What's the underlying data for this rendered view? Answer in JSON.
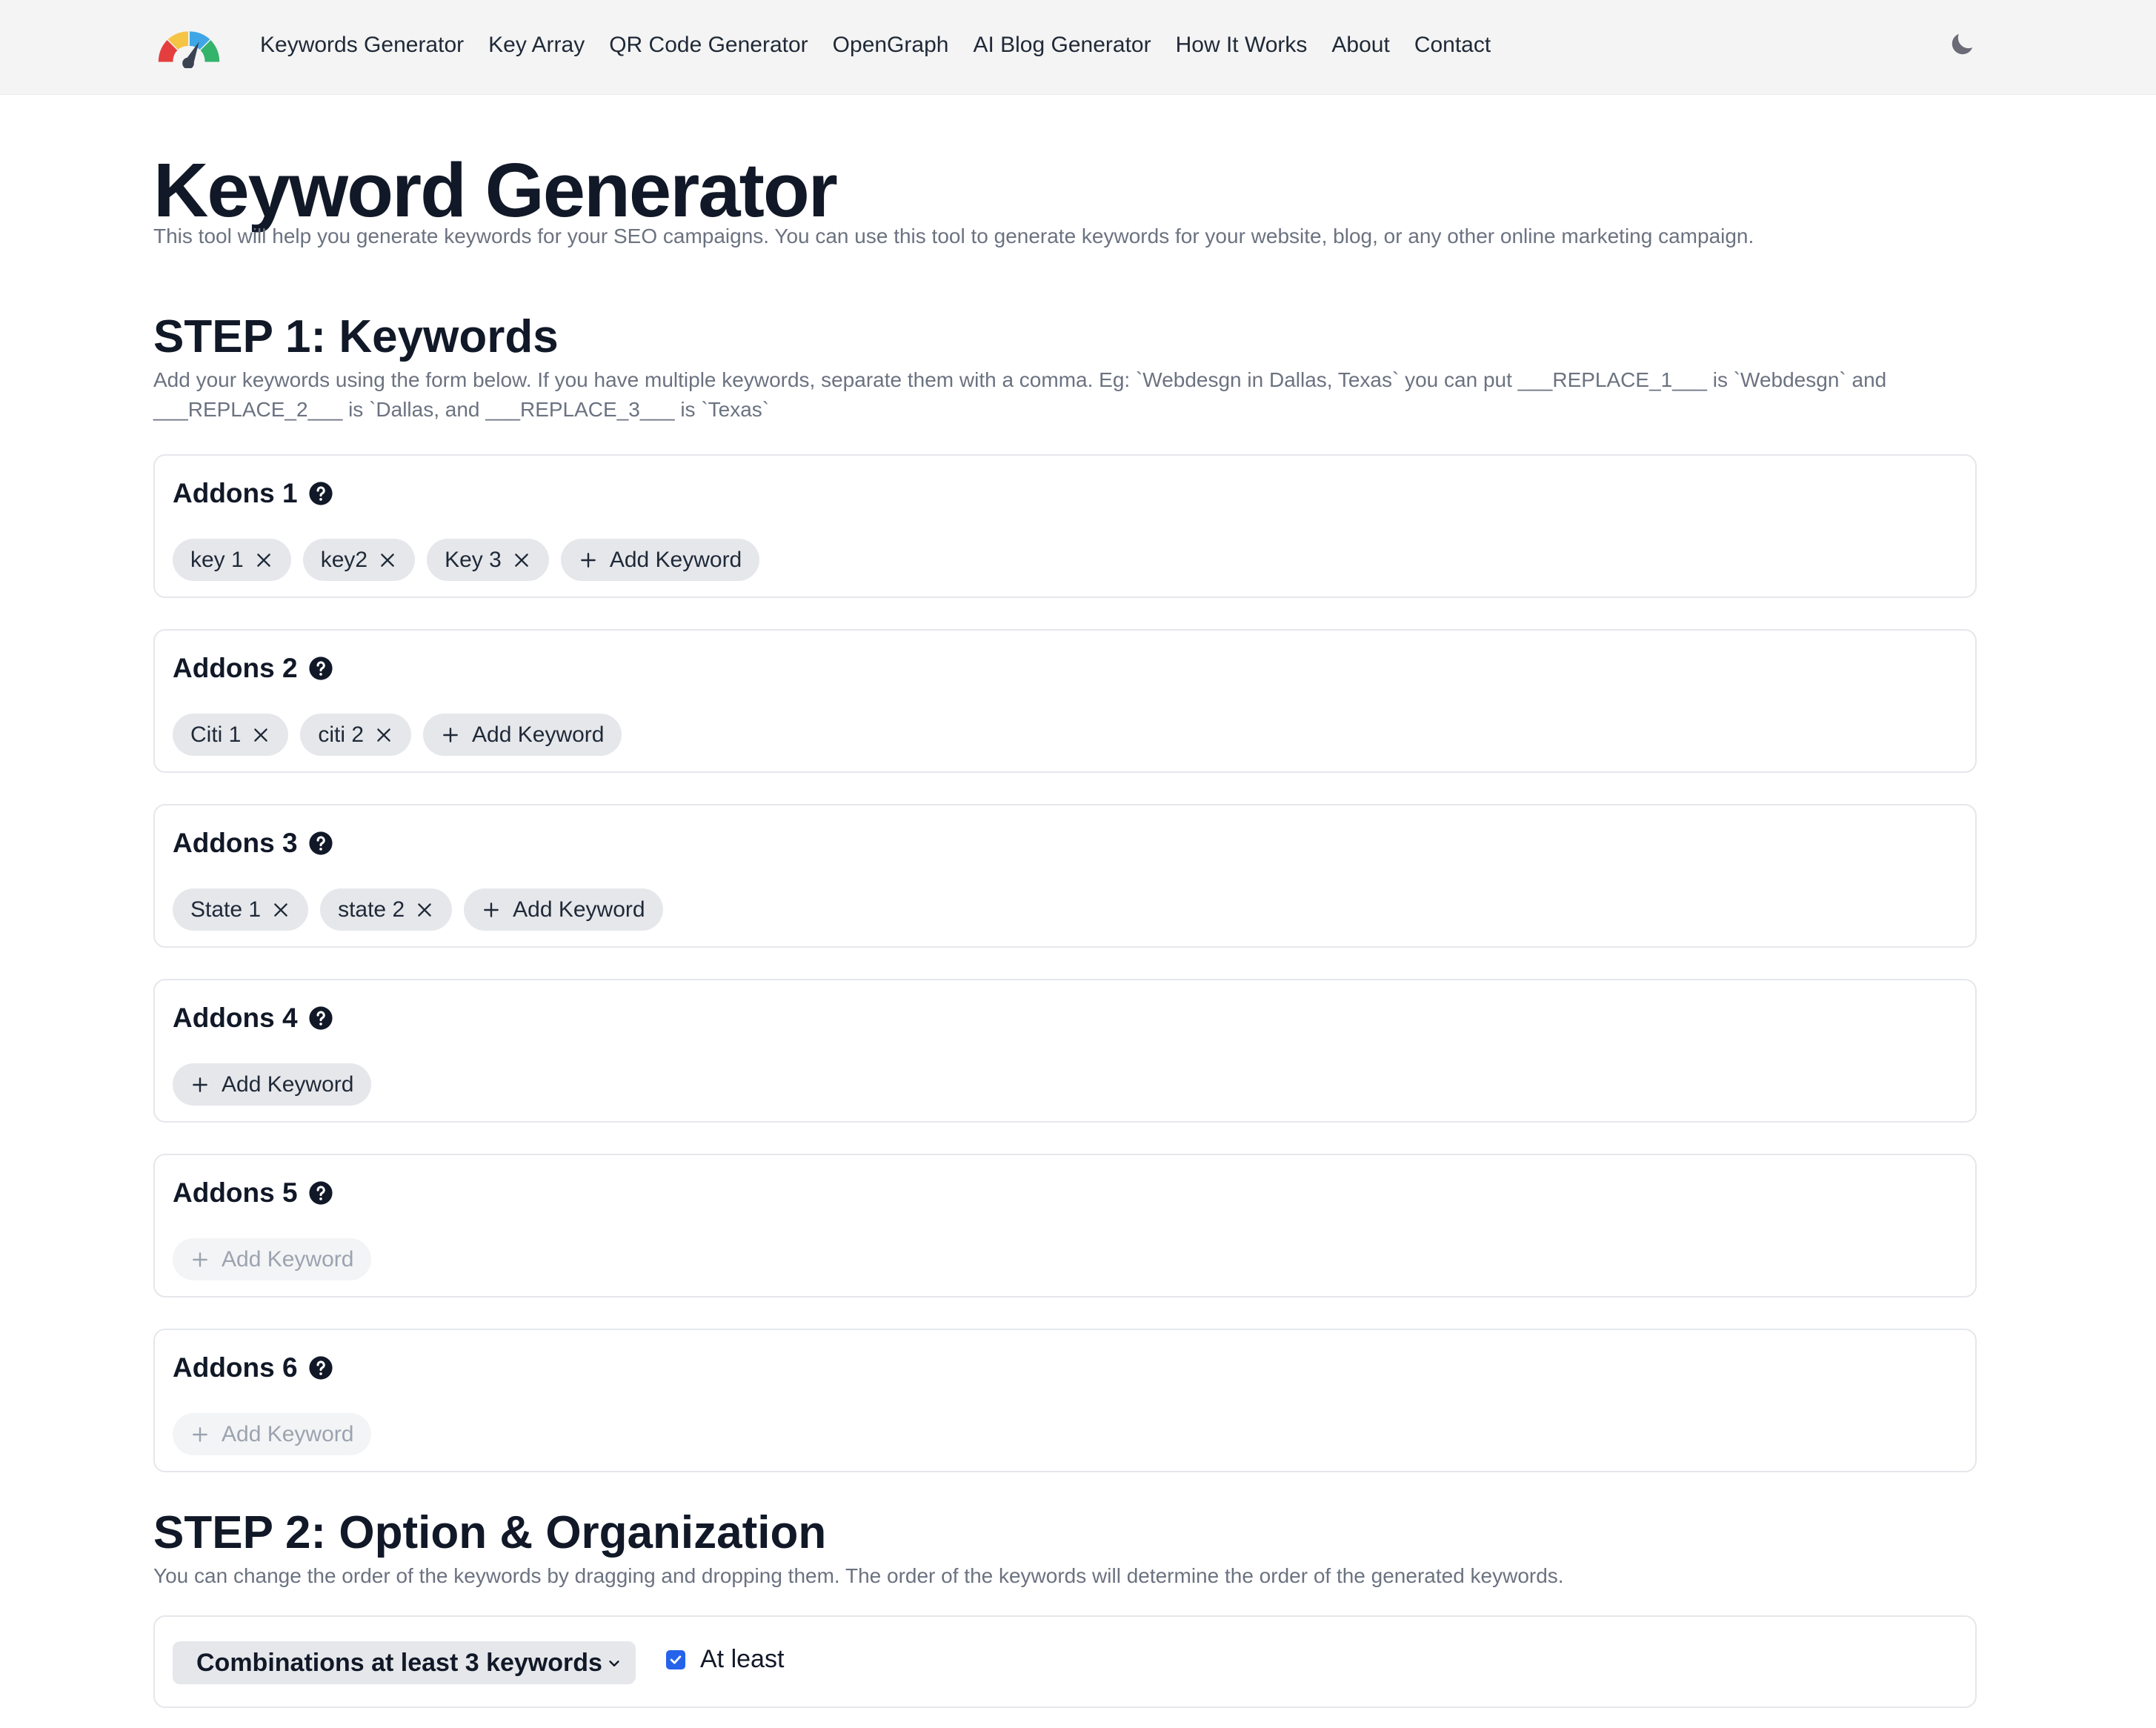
{
  "nav": {
    "links": [
      "Keywords Generator",
      "Key Array",
      "QR Code Generator",
      "OpenGraph",
      "AI Blog Generator",
      "How It Works",
      "About",
      "Contact"
    ]
  },
  "page": {
    "title": "Keyword Generator",
    "description": "This tool will help you generate keywords for your SEO campaigns. You can use this tool to generate keywords for your website, blog, or any other online marketing campaign."
  },
  "step1": {
    "title": "STEP 1: Keywords",
    "description_line1": "Add your keywords using the form below. If you have multiple keywords, separate them with a comma. Eg: `Webdesgn in Dallas, Texas` you can put ___REPLACE_1___ is `Webdesgn` and",
    "description_line2": "___REPLACE_2___ is `Dallas, and ___REPLACE_3___ is `Texas`"
  },
  "addons": [
    {
      "title": "Addons 1",
      "keywords": [
        "key 1",
        "key2",
        "Key 3"
      ],
      "add_label": "Add Keyword",
      "add_enabled": true
    },
    {
      "title": "Addons 2",
      "keywords": [
        "Citi 1",
        "citi 2"
      ],
      "add_label": "Add Keyword",
      "add_enabled": true
    },
    {
      "title": "Addons 3",
      "keywords": [
        "State 1",
        "state 2"
      ],
      "add_label": "Add Keyword",
      "add_enabled": true
    },
    {
      "title": "Addons 4",
      "keywords": [],
      "add_label": "Add Keyword",
      "add_enabled": true
    },
    {
      "title": "Addons 5",
      "keywords": [],
      "add_label": "Add Keyword",
      "add_enabled": false
    },
    {
      "title": "Addons 6",
      "keywords": [],
      "add_label": "Add Keyword",
      "add_enabled": false
    }
  ],
  "step2": {
    "title": "STEP 2: Option & Organization",
    "description": "You can change the order of the keywords by dragging and dropping them. The order of the keywords will determine the order of the generated keywords.",
    "combination_select": "Combinations at least 3 keywords",
    "at_least_label": "At least",
    "at_least_checked": true
  },
  "colors": {
    "nav_bg": "#f4f4f4",
    "chip_bg": "#e5e7eb",
    "checkbox_accent": "#2563eb",
    "logo_red": "#e53e3e",
    "logo_yellow": "#f6c445",
    "logo_blue": "#3ea6e6",
    "logo_green": "#34b36b"
  }
}
